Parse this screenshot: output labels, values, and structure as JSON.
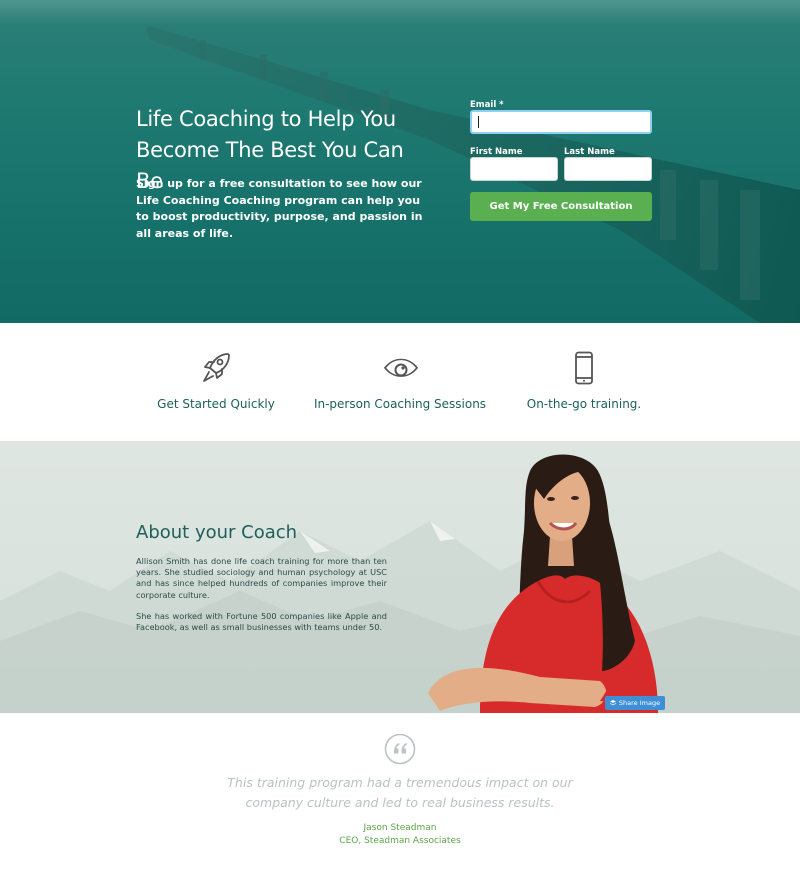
{
  "hero": {
    "title": "Life Coaching to Help You Become The Best You Can Be",
    "description": "Sign up for a free consultation to see how our Life Coaching Coaching program can help you to boost productivity, purpose, and passion in all areas of life.",
    "form": {
      "email_label": "Email *",
      "email_value": "",
      "first_name_label": "First Name",
      "first_name_value": "",
      "last_name_label": "Last Name",
      "last_name_value": "",
      "submit_label": "Get My Free Consultation"
    }
  },
  "features": [
    {
      "icon": "rocket-icon",
      "label": "Get Started Quickly"
    },
    {
      "icon": "eye-icon",
      "label": "In-person Coaching Sessions"
    },
    {
      "icon": "mobile-phone-icon",
      "label": "On-the-go training."
    }
  ],
  "about": {
    "title": "About your Coach",
    "paragraphs": [
      "Allison Smith has done life coach training for more than ten years. She studied sociology and human psychology at USC and has since helped hundreds of companies improve their corporate culture.",
      "She has worked with Fortune 500 companies like Apple and Facebook, as well as small businesses with teams under 50."
    ],
    "share_button_label": "Share Image"
  },
  "testimonial": {
    "quote_icon": "quote-icon",
    "quote": "This training program had a tremendous impact on our company culture and led to real business results.",
    "author_name": "Jason Steadman",
    "author_title": "CEO, Steadman Associates"
  },
  "colors": {
    "hero_bg": "#1f7a72",
    "cta_green": "#5ab050",
    "heading_teal": "#1e5f5a",
    "accent_green": "#5aa64a",
    "share_blue": "#3f8fd6"
  }
}
